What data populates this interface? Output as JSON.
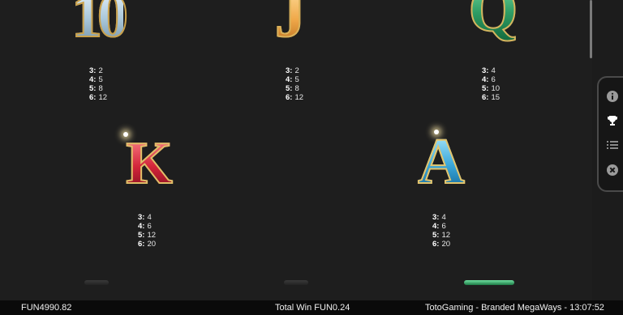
{
  "symbols": [
    {
      "id": "10",
      "glyph": "10",
      "payouts": [
        [
          "3:",
          "2"
        ],
        [
          "4:",
          "5"
        ],
        [
          "5:",
          "8"
        ],
        [
          "6:",
          "12"
        ]
      ]
    },
    {
      "id": "j",
      "glyph": "J",
      "payouts": [
        [
          "3:",
          "2"
        ],
        [
          "4:",
          "5"
        ],
        [
          "5:",
          "8"
        ],
        [
          "6:",
          "12"
        ]
      ]
    },
    {
      "id": "q",
      "glyph": "Q",
      "payouts": [
        [
          "3:",
          "4"
        ],
        [
          "4:",
          "6"
        ],
        [
          "5:",
          "10"
        ],
        [
          "6:",
          "15"
        ]
      ]
    },
    {
      "id": "k",
      "glyph": "K",
      "payouts": [
        [
          "3:",
          "4"
        ],
        [
          "4:",
          "6"
        ],
        [
          "5:",
          "12"
        ],
        [
          "6:",
          "20"
        ]
      ]
    },
    {
      "id": "a",
      "glyph": "A",
      "payouts": [
        [
          "3:",
          "4"
        ],
        [
          "4:",
          "6"
        ],
        [
          "5:",
          "12"
        ],
        [
          "6:",
          "20"
        ]
      ]
    }
  ],
  "side_panel": {
    "buttons": [
      {
        "icon": "info-icon",
        "glyph": "i"
      },
      {
        "icon": "trophy-icon",
        "glyph": "🏆"
      },
      {
        "icon": "list-icon",
        "glyph": "☰"
      },
      {
        "icon": "close-icon",
        "glyph": "✕"
      }
    ]
  },
  "bottom_bar": {
    "balance": "FUN4990.82",
    "total_win": "Total Win FUN0.24",
    "game_info": "TotoGaming - Branded MegaWays - 13:07:52"
  },
  "colors": {
    "background": "#1e1e1e",
    "bottom_bar": "#0a0a0a",
    "ten": "#a9c7da",
    "j": "#f0a94a",
    "q": "#2e9c64",
    "k": "#d3253a",
    "a": "#3aa7d9",
    "gold_trim": "#d9b15a"
  }
}
